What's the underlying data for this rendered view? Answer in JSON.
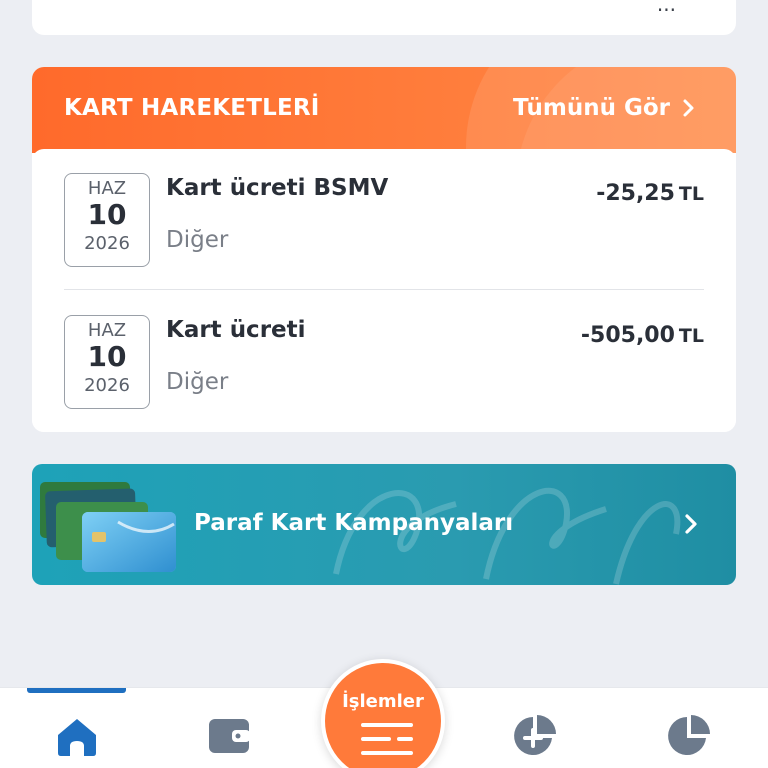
{
  "top_card": {
    "cut_text": "..."
  },
  "transactions": {
    "title": "KART HAREKETLERİ",
    "see_all": "Tümünü Gör",
    "items": [
      {
        "month": "HAZ",
        "day": "10",
        "year": "2026",
        "name": "Kart ücreti BSMV",
        "category": "Diğer",
        "amount": "-25,25",
        "currency": "TL"
      },
      {
        "month": "HAZ",
        "day": "10",
        "year": "2026",
        "name": "Kart ücreti",
        "category": "Diğer",
        "amount": "-505,00",
        "currency": "TL"
      }
    ]
  },
  "promo": {
    "title": "Paraf Kart Kampanyaları"
  },
  "tabbar": {
    "fab_label": "İşlemler",
    "tabs": [
      "home-icon",
      "wallet-icon",
      "islemler-icon",
      "pie-plus-icon",
      "pie-chart-icon"
    ]
  },
  "colors": {
    "accent_orange": "#ff6a2b",
    "promo_teal": "#1ea2b8",
    "active_blue": "#1f6fc0",
    "tab_icon": "#6c7a8c"
  }
}
